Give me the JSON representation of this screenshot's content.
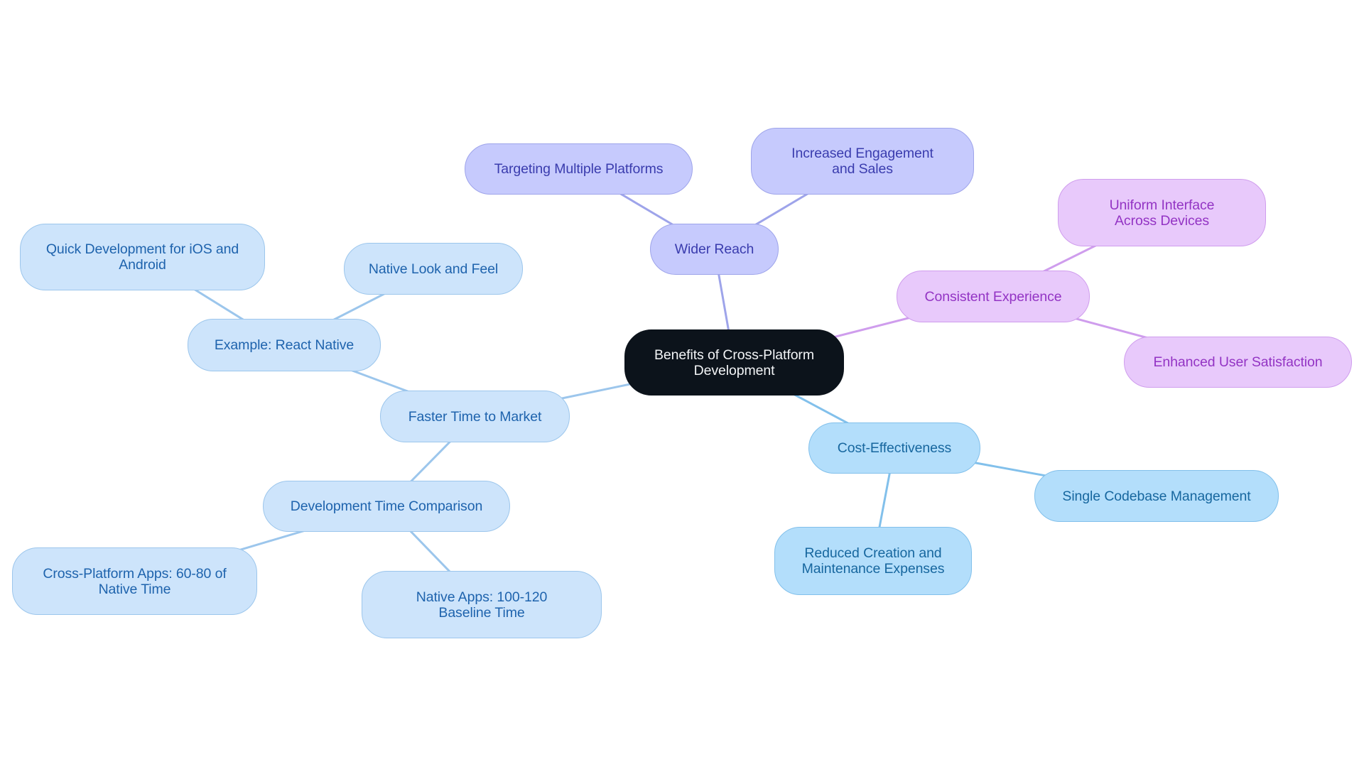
{
  "diagram": {
    "type": "mind-map",
    "root": {
      "id": "root",
      "label": "Benefits of Cross-Platform Development"
    },
    "branches": [
      {
        "id": "wider",
        "label": "Wider Reach",
        "color": "#9ea4ea",
        "children": [
          {
            "id": "targeting",
            "label": "Targeting Multiple Platforms"
          },
          {
            "id": "engagement",
            "label": "Increased Engagement and Sales"
          }
        ]
      },
      {
        "id": "consistent",
        "label": "Consistent Experience",
        "color": "#cf9ded",
        "children": [
          {
            "id": "uniform",
            "label": "Uniform Interface Across Devices"
          },
          {
            "id": "enhanced",
            "label": "Enhanced User Satisfaction"
          }
        ]
      },
      {
        "id": "cost",
        "label": "Cost-Effectiveness",
        "color": "#82c0eb",
        "children": [
          {
            "id": "single",
            "label": "Single Codebase Management"
          },
          {
            "id": "reduced",
            "label": "Reduced Creation and Maintenance Expenses"
          }
        ]
      },
      {
        "id": "faster",
        "label": "Faster Time to Market",
        "color": "#9cc6ec",
        "children": [
          {
            "id": "example",
            "label": "Example: React Native",
            "children": [
              {
                "id": "quick",
                "label": "Quick Development for iOS and Android"
              },
              {
                "id": "native_look",
                "label": "Native Look and Feel"
              }
            ]
          },
          {
            "id": "devtime",
            "label": "Development Time Comparison",
            "children": [
              {
                "id": "xplat_apps",
                "label": "Cross-Platform Apps: 60-80 of Native Time"
              },
              {
                "id": "native_apps",
                "label": "Native Apps: 100-120 Baseline Time"
              }
            ]
          }
        ]
      }
    ]
  },
  "colors": {
    "root_fill": "#0c131b",
    "wider_reach": "#c6cafd",
    "consistent_experience": "#e8c9fb",
    "cost_effectiveness": "#b3defb",
    "faster_time_to_market": "#cde4fb"
  }
}
